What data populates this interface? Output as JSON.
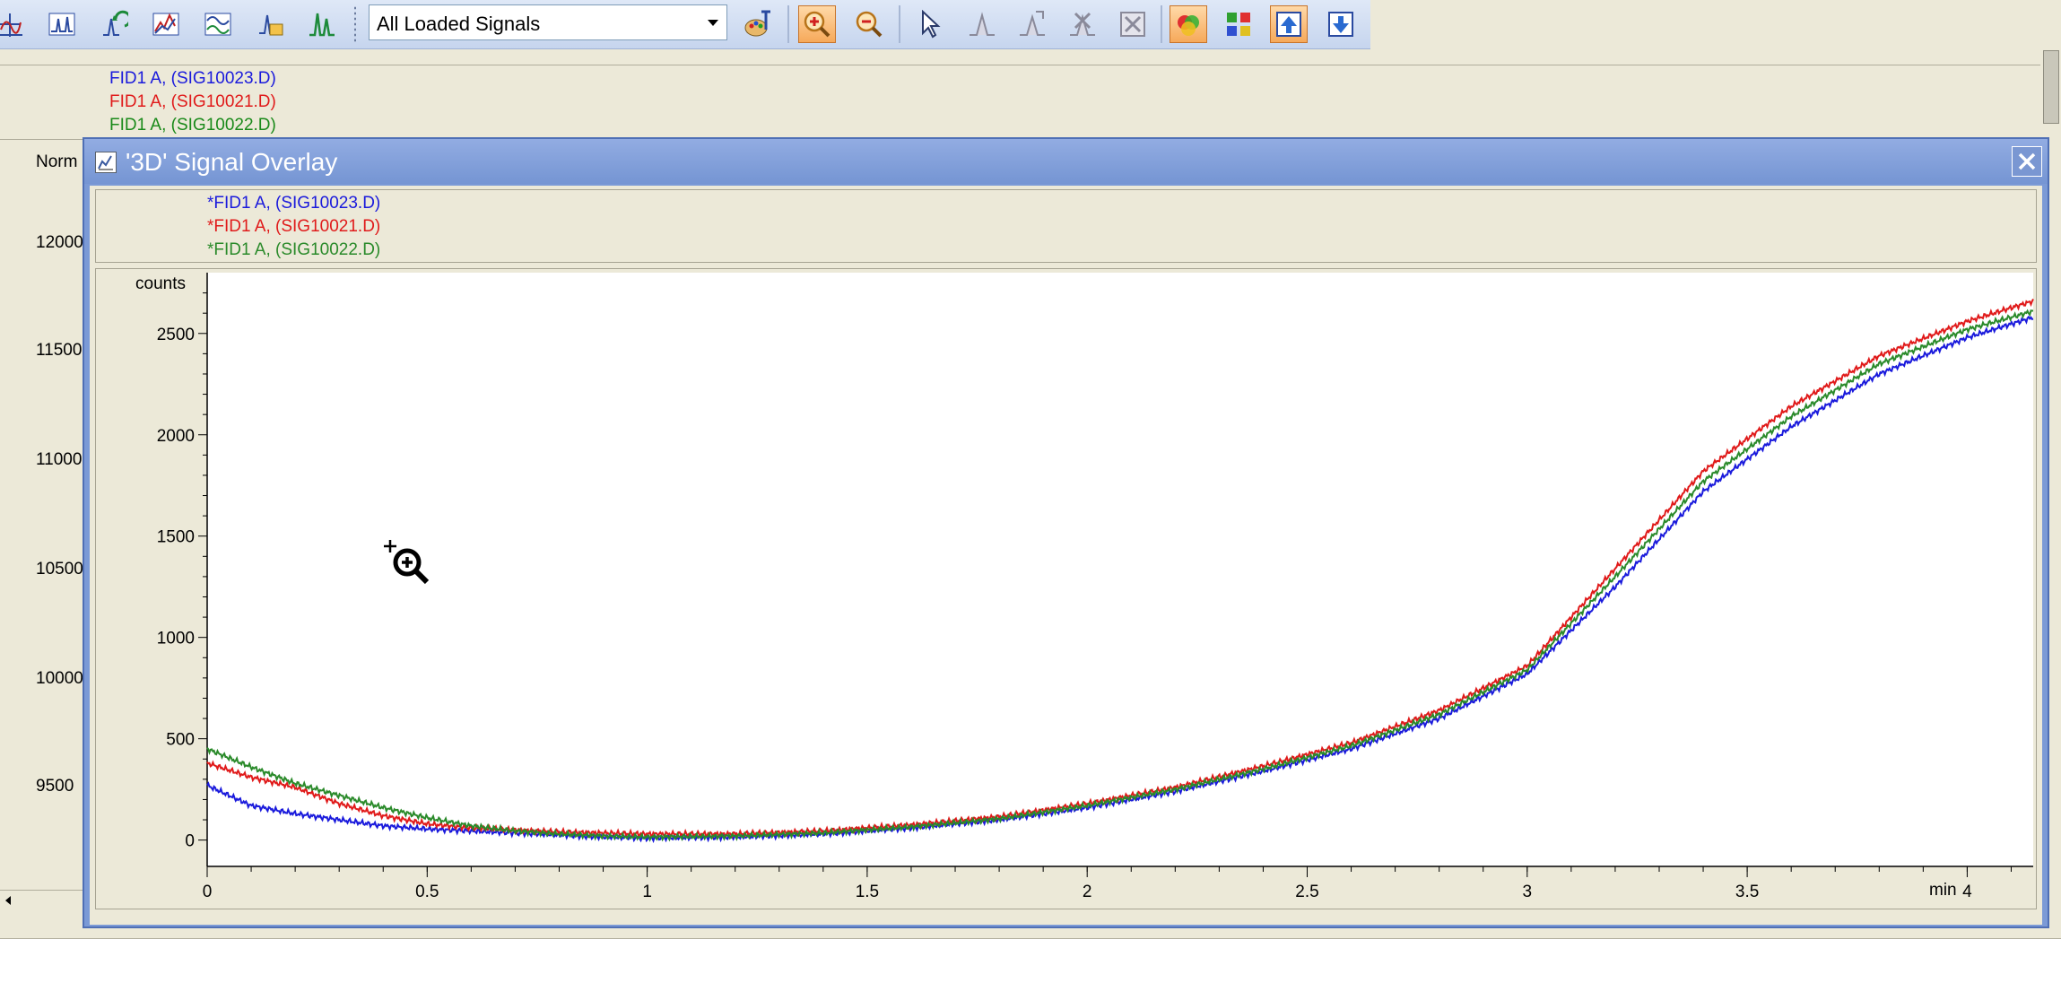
{
  "toolbar": {
    "signal_select": "All Loaded Signals"
  },
  "background_chart": {
    "legend": [
      {
        "label": "FID1 A, (SIG10023.D)",
        "color": "#1a1adc"
      },
      {
        "label": "FID1 A, (SIG10021.D)",
        "color": "#e01a1a"
      },
      {
        "label": "FID1 A, (SIG10022.D)",
        "color": "#1a8a1a"
      }
    ],
    "ylabel": "Norm",
    "yticks": [
      "12000",
      "11500",
      "11000",
      "10500",
      "10000",
      "9500"
    ]
  },
  "dialog": {
    "title": "'3D' Signal Overlay"
  },
  "chart_data": {
    "type": "line",
    "ylabel": "counts",
    "xlabel": "min",
    "xlim": [
      0,
      4.15
    ],
    "ylim": [
      -130,
      2800
    ],
    "xticks": [
      "0",
      "0.5",
      "1",
      "1.5",
      "2",
      "2.5",
      "3",
      "3.5",
      "4"
    ],
    "yticks": [
      "0",
      "500",
      "1000",
      "1500",
      "2000",
      "2500"
    ],
    "x": [
      0,
      0.1,
      0.2,
      0.3,
      0.4,
      0.5,
      0.6,
      0.7,
      0.8,
      0.9,
      1.0,
      1.2,
      1.4,
      1.6,
      1.8,
      2.0,
      2.2,
      2.4,
      2.6,
      2.8,
      3.0,
      3.2,
      3.4,
      3.6,
      3.8,
      4.0,
      4.15
    ],
    "series": [
      {
        "name": "*FID1 A, (SIG10023.D)",
        "color": "#1a1adc",
        "values": [
          270,
          170,
          130,
          100,
          70,
          55,
          45,
          35,
          25,
          15,
          10,
          15,
          30,
          60,
          100,
          160,
          240,
          340,
          450,
          600,
          820,
          1250,
          1720,
          2040,
          2300,
          2480,
          2580
        ]
      },
      {
        "name": "*FID1 A, (SIG10021.D)",
        "color": "#e01a1a",
        "values": [
          380,
          310,
          260,
          180,
          120,
          80,
          60,
          50,
          40,
          35,
          30,
          30,
          45,
          75,
          115,
          180,
          260,
          365,
          480,
          640,
          860,
          1340,
          1820,
          2140,
          2390,
          2560,
          2660
        ]
      },
      {
        "name": "*FID1 A, (SIG10022.D)",
        "color": "#2a8a2a",
        "values": [
          450,
          360,
          280,
          220,
          160,
          110,
          70,
          45,
          30,
          20,
          15,
          20,
          35,
          65,
          105,
          170,
          250,
          350,
          465,
          620,
          840,
          1300,
          1770,
          2090,
          2350,
          2520,
          2610
        ]
      }
    ]
  }
}
